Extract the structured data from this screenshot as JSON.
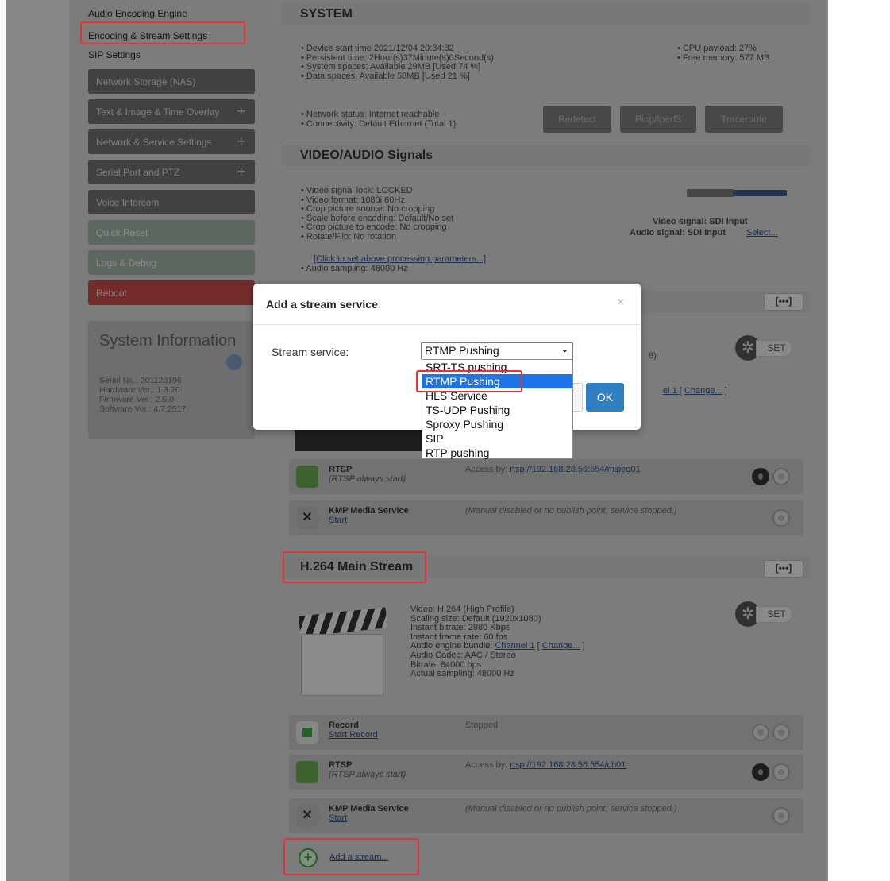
{
  "sidebar": {
    "links": [
      "Audio Encoding Engine",
      "Encoding & Stream Settings",
      "SIP Settings"
    ],
    "buttons": [
      {
        "label": "Network Storage (NAS)",
        "plus": ""
      },
      {
        "label": "Text & Image & Time Overlay",
        "plus": "+"
      },
      {
        "label": "Network & Service Settings",
        "plus": "+"
      },
      {
        "label": "Serial Port and PTZ",
        "plus": "+"
      },
      {
        "label": "Voice Intercom",
        "plus": ""
      },
      {
        "label": "Quick Reset",
        "plus": ""
      },
      {
        "label": "Logs & Debug",
        "plus": ""
      },
      {
        "label": "Reboot",
        "plus": ""
      }
    ],
    "sysinfo": {
      "title": "System Information",
      "serial": "Serial No.: 201120196",
      "hardware": "Hardware Ver.: 1.3.20",
      "firmware": "Firmware Ver.: 2.5.0",
      "software": "Software Ver.: 4.7.2517"
    }
  },
  "system": {
    "title": "SYSTEM",
    "bullets": [
      "Device start time 2021/12/04 20:34:32",
      "Persistent time: 2Hour(s)37Minute(s)0Second(s)",
      "System spaces: Available 29MB [Used 74 %]",
      "Data spaces: Available 58MB [Used 21 %]"
    ],
    "right_bullets": [
      "CPU payload: 27%",
      "Free memory: 577 MB"
    ],
    "network_bullets": [
      "Network status: Internet reachable",
      "Connectivity: Default Ethernet (Total 1)"
    ],
    "buttons": {
      "redetect": "Redetect",
      "ping": "Ping/Iperf3",
      "traceroute": "Traceroute"
    }
  },
  "signals": {
    "title": "VIDEO/AUDIO Signals",
    "bullets": [
      "Video signal lock: LOCKED",
      "Video format: 1080i 60Hz",
      "Crop picture source: No cropping",
      "Scale before encoding: Default/No set",
      "Crop picture to encode: No cropping",
      "Rotate/Flip: No rotation"
    ],
    "param_link": "[Click to set above processing parameters...]",
    "audio_bullet": "Audio sampling: 48000 Hz",
    "video_signal": "Video signal: SDI Input",
    "audio_signal": "Audio signal: SDI Input",
    "select_link": "Select..."
  },
  "stream1": {
    "more": "[•••]",
    "partial_info": "8)",
    "channel_text": "el 1 [",
    "change": "Change...",
    "bracket": "]",
    "set": "SET",
    "rtsp": {
      "name": "RTSP",
      "sub": "(RTSP always start)",
      "access_label": "Access by:",
      "url": "rtsp://192.168.28.56:554/mjpeg01"
    },
    "kmp": {
      "name": "KMP Media Service",
      "start": "Start",
      "status": "(Manual disabled or no publish point, service stopped.)"
    }
  },
  "main_stream": {
    "title": "H.264 Main Stream",
    "more": "[•••]",
    "set": "SET",
    "video": "Video: H.264 (High Profile)",
    "scaling": "Scaling size: Default (1920x1080)",
    "bitrate_instant": "Instant bitrate: 2980 Kbps",
    "framerate": "Instant frame rate: 60 fps",
    "audio_bundle_label": "Audio engine bundle:",
    "audio_bundle_link": "Channel 1",
    "change": "Change...",
    "audio_codec": "Audio Codec: AAC / Stereo",
    "bitrate": "Bitrate: 64000 bps",
    "sampling": "Actual sampling: 48000 Hz",
    "record": {
      "name": "Record",
      "start": "Start Record",
      "status": "Stopped"
    },
    "rtsp": {
      "name": "RTSP",
      "sub": "(RTSP always start)",
      "access_label": "Access by:",
      "url": "rtsp://192.168.28.56:554/ch01"
    },
    "kmp": {
      "name": "KMP Media Service",
      "start": "Start",
      "status": "(Manual disabled or no publish point, service stopped.)"
    },
    "add_stream": "Add a stream..."
  },
  "modal": {
    "title": "Add a stream service",
    "close": "×",
    "field_label": "Stream service:",
    "selected": "RTMP Pushing",
    "options": [
      "SRT-TS pushing",
      "RTMP Pushing",
      "HLS Service",
      "TS-UDP Pushing",
      "Sproxy Pushing",
      "SIP",
      "RTP pushing"
    ],
    "ok": "OK"
  }
}
